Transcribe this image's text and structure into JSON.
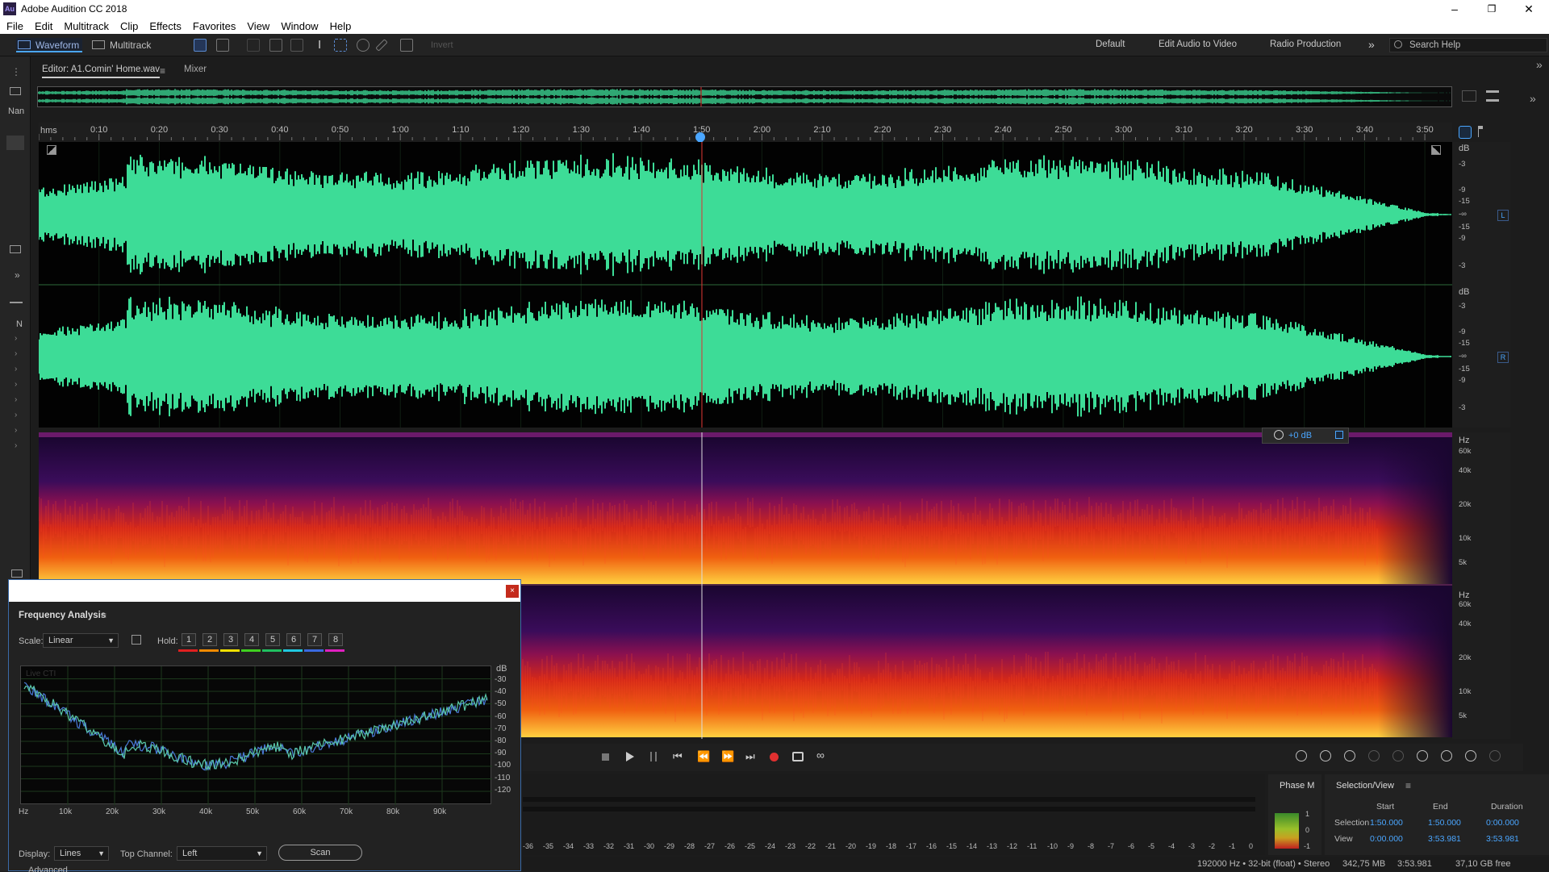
{
  "window": {
    "title": "Adobe Audition CC 2018",
    "logo": "Au"
  },
  "menu": [
    "File",
    "Edit",
    "Multitrack",
    "Clip",
    "Effects",
    "Favorites",
    "View",
    "Window",
    "Help"
  ],
  "toolbar": {
    "waveform": "Waveform",
    "multitrack": "Multitrack",
    "invert": "Invert",
    "workspaces": [
      "Default",
      "Edit Audio to Video",
      "Radio Production"
    ],
    "search_placeholder": "Search Help"
  },
  "editor": {
    "tab": "Editor: A1.Comin' Home.wav",
    "mixer": "Mixer"
  },
  "ruler": {
    "unit": "hms",
    "ticks": [
      "0:10",
      "0:20",
      "0:30",
      "0:40",
      "0:50",
      "1:00",
      "1:10",
      "1:20",
      "1:30",
      "1:40",
      "1:50",
      "2:00",
      "2:10",
      "2:20",
      "2:30",
      "2:40",
      "2:50",
      "3:00",
      "3:10",
      "3:20",
      "3:30",
      "3:40",
      "3:50"
    ]
  },
  "db_scale": {
    "unit": "dB",
    "ticks": [
      "-3",
      "-9",
      "-15",
      "-∞",
      "-15",
      "-9",
      "-3"
    ],
    "channels": [
      "L",
      "R"
    ]
  },
  "hz_scale": {
    "unit": "Hz",
    "top_ticks": [
      "60k",
      "40k",
      "20k",
      "10k",
      "5k"
    ],
    "bottom_ticks": [
      "60k",
      "40k",
      "20k",
      "10k",
      "5k"
    ]
  },
  "hud": {
    "gain": "+0 dB"
  },
  "left_strip": {
    "files_label": "Nan",
    "n_label": "N"
  },
  "freq_analysis": {
    "title": "Frequency Analysis",
    "scale_label": "Scale:",
    "scale_value": "Linear",
    "hold_label": "Hold:",
    "holds": [
      "1",
      "2",
      "3",
      "4",
      "5",
      "6",
      "7",
      "8"
    ],
    "hold_colors": [
      "#e02020",
      "#f08a00",
      "#f0e000",
      "#40d020",
      "#20c060",
      "#20c8e0",
      "#3a6ae0",
      "#e020c0"
    ],
    "live_label": "Live CTI",
    "db_unit": "dB",
    "db_ticks": [
      "-30",
      "-40",
      "-50",
      "-60",
      "-70",
      "-80",
      "-90",
      "-100",
      "-110",
      "-120"
    ],
    "hz_ticks": [
      "Hz",
      "10k",
      "20k",
      "30k",
      "40k",
      "50k",
      "60k",
      "70k",
      "80k",
      "90k"
    ],
    "display_label": "Display:",
    "display_value": "Lines",
    "top_channel_label": "Top Channel:",
    "top_channel_value": "Left",
    "scan": "Scan",
    "advanced": "Advanced",
    "close": "×"
  },
  "meter_ticks": [
    "-36",
    "-35",
    "-34",
    "-33",
    "-32",
    "-31",
    "-30",
    "-29",
    "-28",
    "-27",
    "-26",
    "-25",
    "-24",
    "-23",
    "-22",
    "-21",
    "-20",
    "-19",
    "-18",
    "-17",
    "-16",
    "-15",
    "-14",
    "-13",
    "-12",
    "-11",
    "-10",
    "-9",
    "-8",
    "-7",
    "-6",
    "-5",
    "-4",
    "-3",
    "-2",
    "-1",
    "0"
  ],
  "phase": {
    "title": "Phase M",
    "ticks": [
      "1",
      "0",
      "-1"
    ]
  },
  "selection_view": {
    "title": "Selection/View",
    "headers": [
      "Start",
      "End",
      "Duration"
    ],
    "rows": [
      {
        "label": "Selection",
        "start": "1:50.000",
        "end": "1:50.000",
        "duration": "0:00.000"
      },
      {
        "label": "View",
        "start": "0:00.000",
        "end": "3:53.981",
        "duration": "3:53.981"
      }
    ]
  },
  "status": {
    "format": "192000 Hz • 32-bit (float) • Stereo",
    "size": "342,75 MB",
    "duration": "3:53.981",
    "free": "37,10 GB free"
  },
  "colors": {
    "waveform": "#3ddc97",
    "playhead": "#e03030",
    "accent": "#4aa6ff"
  }
}
